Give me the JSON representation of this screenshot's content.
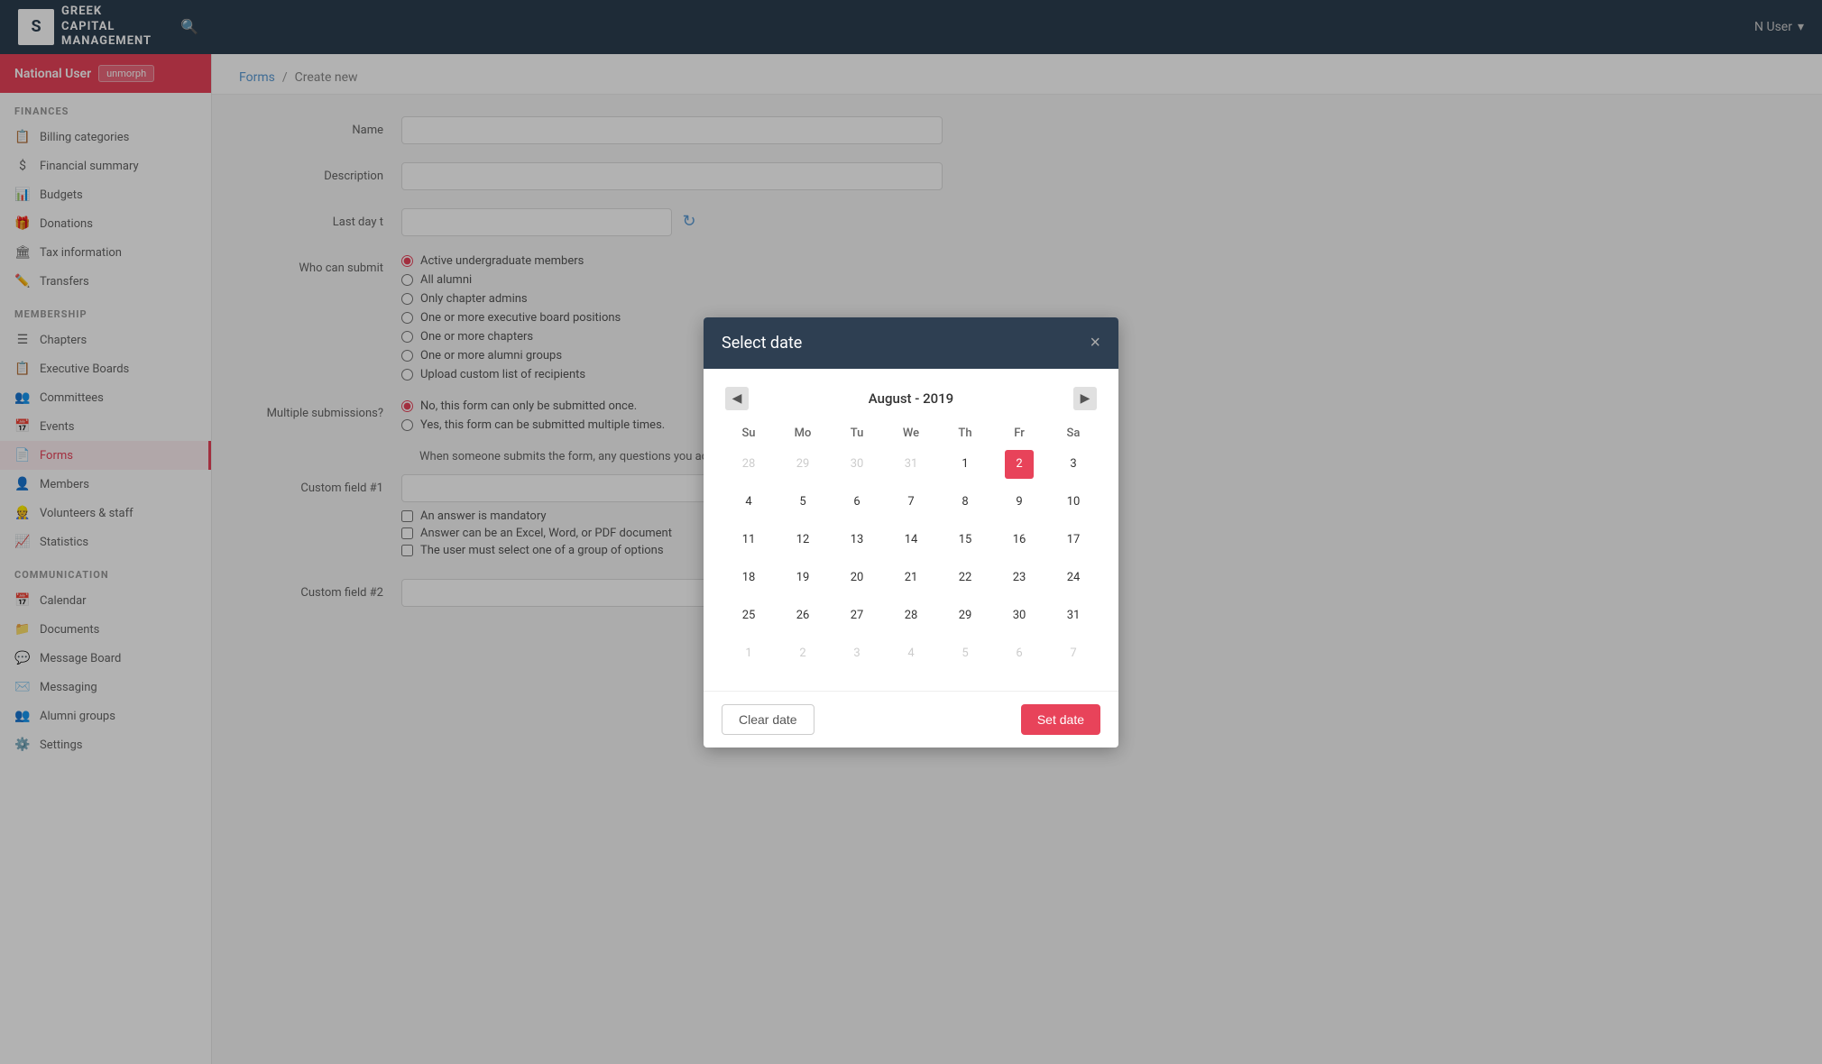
{
  "app": {
    "logo_letter": "S",
    "logo_text_line1": "GREEK",
    "logo_text_line2": "CAPITAL",
    "logo_text_line3": "MANAGEMENT"
  },
  "topbar": {
    "user_label": "N User",
    "chevron": "▾"
  },
  "sidebar": {
    "user_name": "National User",
    "user_badge": "unmorph",
    "sections": [
      {
        "label": "FINANCES",
        "items": [
          {
            "icon": "📋",
            "text": "Billing categories"
          },
          {
            "icon": "$",
            "text": "Financial summary"
          },
          {
            "icon": "📊",
            "text": "Budgets"
          },
          {
            "icon": "🎁",
            "text": "Donations"
          },
          {
            "icon": "🏛",
            "text": "Tax information"
          },
          {
            "icon": "✏️",
            "text": "Transfers"
          }
        ]
      },
      {
        "label": "MEMBERSHIP",
        "items": [
          {
            "icon": "☰",
            "text": "Chapters"
          },
          {
            "icon": "📋",
            "text": "Executive Boards"
          },
          {
            "icon": "👥",
            "text": "Committees"
          },
          {
            "icon": "📅",
            "text": "Events"
          },
          {
            "icon": "📄",
            "text": "Forms",
            "active": true
          },
          {
            "icon": "👤",
            "text": "Members"
          },
          {
            "icon": "👷",
            "text": "Volunteers & staff"
          },
          {
            "icon": "📈",
            "text": "Statistics"
          }
        ]
      },
      {
        "label": "COMMUNICATION",
        "items": [
          {
            "icon": "📅",
            "text": "Calendar"
          },
          {
            "icon": "📁",
            "text": "Documents"
          },
          {
            "icon": "💬",
            "text": "Message Board"
          },
          {
            "icon": "✉️",
            "text": "Messaging"
          },
          {
            "icon": "👥",
            "text": "Alumni groups"
          }
        ]
      },
      {
        "label": "",
        "items": [
          {
            "icon": "⚙️",
            "text": "Settings"
          }
        ]
      }
    ]
  },
  "breadcrumb": {
    "parent": "Forms",
    "separator": "/",
    "current": "Create new"
  },
  "form": {
    "name_label": "Name",
    "description_label": "Description",
    "last_day_label": "Last day t",
    "who_can_submit_label": "Who can submit",
    "multiple_submissions_label": "Multiple submissions?",
    "custom_field1_label": "Custom field #1",
    "custom_field2_label": "Custom field #2",
    "who_can_submit_options": [
      "Active undergraduate members",
      "All alumni",
      "Only chapter admins",
      "One or more executive board positions",
      "One or more chapters",
      "One or more alumni groups",
      "Upload custom list of recipients"
    ],
    "multiple_submissions_options": [
      "No, this form can only be submitted once.",
      "Yes, this form can be submitted multiple times."
    ],
    "custom_field_options": [
      "An answer is mandatory",
      "Answer can be an Excel, Word, or PDF document",
      "The user must select one of a group of options"
    ],
    "helper_text": "When someone submits the form, any questions you add here will be asked."
  },
  "modal": {
    "title": "Select date",
    "close_icon": "×",
    "calendar": {
      "month_label": "August - 2019",
      "prev_icon": "◀",
      "next_icon": "▶",
      "weekdays": [
        "Su",
        "Mo",
        "Tu",
        "We",
        "Th",
        "Fr",
        "Sa"
      ],
      "weeks": [
        [
          {
            "day": 28,
            "other": true
          },
          {
            "day": 29,
            "other": true
          },
          {
            "day": 30,
            "other": true
          },
          {
            "day": 31,
            "other": true
          },
          {
            "day": 1
          },
          {
            "day": 2,
            "selected": true
          },
          {
            "day": 3
          }
        ],
        [
          {
            "day": 4
          },
          {
            "day": 5
          },
          {
            "day": 6
          },
          {
            "day": 7
          },
          {
            "day": 8
          },
          {
            "day": 9
          },
          {
            "day": 10
          }
        ],
        [
          {
            "day": 11
          },
          {
            "day": 12
          },
          {
            "day": 13
          },
          {
            "day": 14
          },
          {
            "day": 15
          },
          {
            "day": 16
          },
          {
            "day": 17
          }
        ],
        [
          {
            "day": 18
          },
          {
            "day": 19
          },
          {
            "day": 20
          },
          {
            "day": 21
          },
          {
            "day": 22
          },
          {
            "day": 23
          },
          {
            "day": 24
          }
        ],
        [
          {
            "day": 25
          },
          {
            "day": 26
          },
          {
            "day": 27
          },
          {
            "day": 28
          },
          {
            "day": 29
          },
          {
            "day": 30
          },
          {
            "day": 31
          }
        ],
        [
          {
            "day": 1,
            "other": true
          },
          {
            "day": 2,
            "other": true
          },
          {
            "day": 3,
            "other": true
          },
          {
            "day": 4,
            "other": true
          },
          {
            "day": 5,
            "other": true
          },
          {
            "day": 6,
            "other": true
          },
          {
            "day": 7,
            "other": true
          }
        ]
      ]
    },
    "clear_button": "Clear date",
    "set_button": "Set date"
  }
}
